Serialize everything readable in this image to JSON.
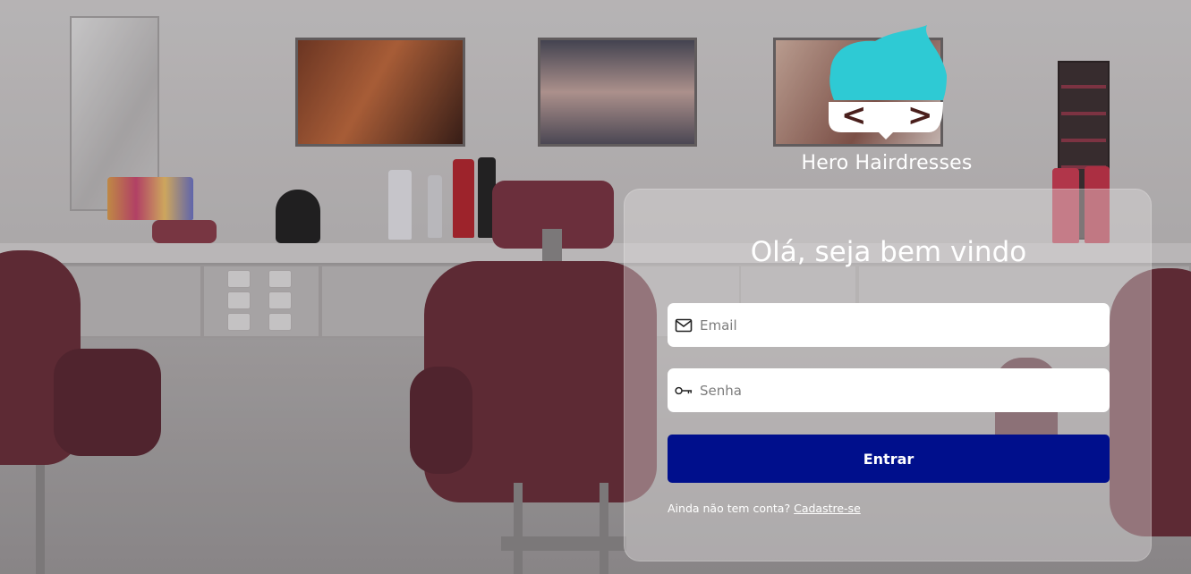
{
  "brand": {
    "name": "Hero Hairdresses",
    "logo_glyph_left": "<",
    "logo_glyph_right": ">",
    "hair_color": "#2ecad4",
    "mask_glyph_color": "#4a1f1c"
  },
  "login": {
    "welcome": "Olá, seja bem vindo",
    "email_placeholder": "Email",
    "password_placeholder": "Senha",
    "submit_label": "Entrar",
    "signup_prompt": "Ainda não tem conta?",
    "signup_link": "Cadastre-se",
    "button_color": "#000f8c"
  },
  "icons": {
    "email": "envelope-icon",
    "password": "key-icon"
  }
}
